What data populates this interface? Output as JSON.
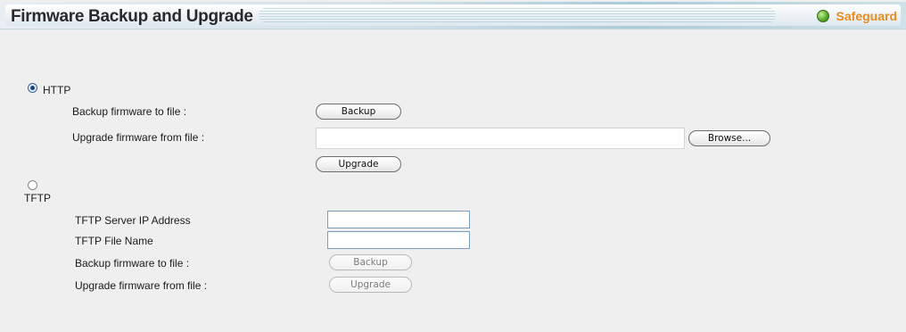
{
  "header": {
    "title": "Firmware Backup and Upgrade",
    "safeguard_label": "Safeguard",
    "safeguard_icon": "status-dot-icon",
    "safeguard_color": "#e98b1f"
  },
  "http": {
    "radio_label": "HTTP",
    "selected": true,
    "backup_label": "Backup firmware to file :",
    "backup_button": "Backup",
    "upgrade_label": "Upgrade firmware from file :",
    "file_value": "",
    "browse_button": "Browse...",
    "upgrade_button": "Upgrade"
  },
  "tftp": {
    "radio_label": "TFTP",
    "selected": false,
    "server_ip_label": "TFTP Server IP Address",
    "server_ip_value": "",
    "file_name_label": "TFTP File Name",
    "file_name_value": "",
    "backup_label": "Backup firmware to file :",
    "backup_button": "Backup",
    "upgrade_label": "Upgrade firmware from file :",
    "upgrade_button": "Upgrade"
  }
}
